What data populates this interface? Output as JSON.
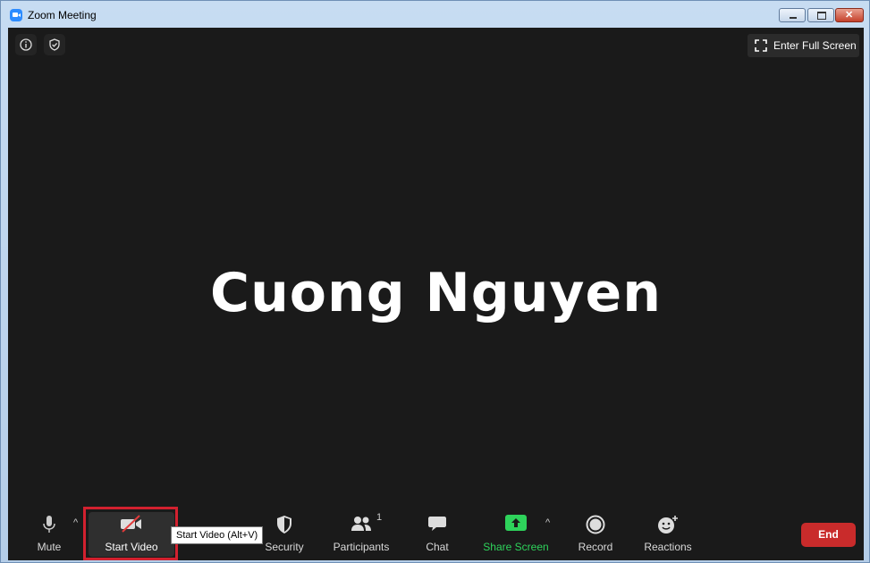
{
  "window": {
    "title": "Zoom Meeting"
  },
  "meeting": {
    "participant_name": "Cuong Nguyen",
    "fullscreen_label": "Enter Full Screen"
  },
  "toolbar": {
    "mute_label": "Mute",
    "start_video_label": "Start Video",
    "security_label": "Security",
    "participants_label": "Participants",
    "participants_count": "1",
    "chat_label": "Chat",
    "share_screen_label": "Share Screen",
    "record_label": "Record",
    "reactions_label": "Reactions",
    "end_label": "End",
    "tooltip": "Start Video (Alt+V)"
  },
  "colors": {
    "stage_bg": "#1a1a1a",
    "share_green": "#2ed35b",
    "end_red": "#c92b2b",
    "highlight_red": "#d2212f"
  },
  "icons": {
    "app": "zoom-camera-icon",
    "info": "info-icon",
    "shield": "shield-check-icon",
    "fullscreen": "expand-corners-icon",
    "mute": "microphone-icon",
    "video": "video-off-icon",
    "security": "shield-icon",
    "participants": "people-icon",
    "chat": "chat-bubble-icon",
    "share": "share-arrow-icon",
    "record": "record-circle-icon",
    "reactions": "smiley-plus-icon"
  }
}
